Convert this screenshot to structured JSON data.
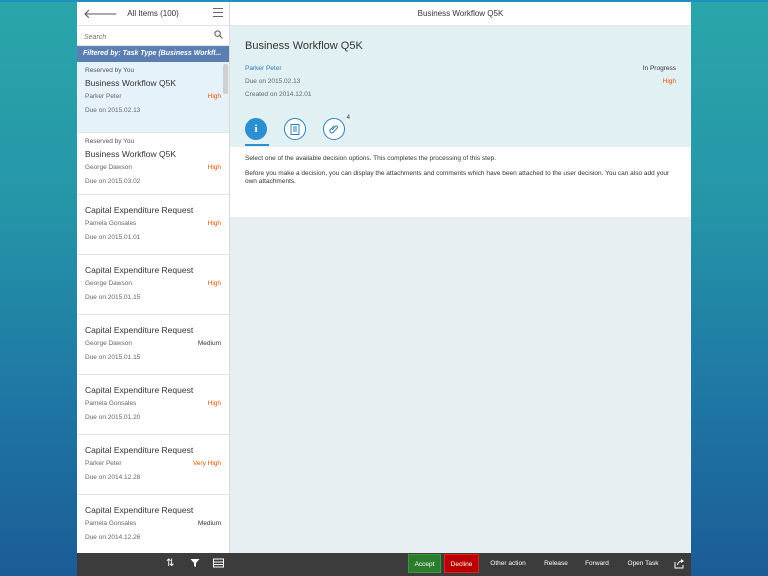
{
  "master": {
    "title": "All Items (100)",
    "search_placeholder": "Search",
    "filter": "Filtered by: Task Type (Business Workfl...",
    "items": [
      {
        "reserved": "Reserved by You",
        "title": "Business Workflow Q5K",
        "person": "Parker Peter",
        "priority": "High",
        "due": "Due on 2015.02.13"
      },
      {
        "reserved": "Reserved by You",
        "title": "Business Workflow Q5K",
        "person": "George Dawson",
        "priority": "High",
        "due": "Due on 2015.03.02"
      },
      {
        "title": "Capital Expenditure Request",
        "person": "Pamela Gonsales",
        "priority": "High",
        "due": "Due on 2015.01.01"
      },
      {
        "title": "Capital Expenditure Request",
        "person": "George Dawson",
        "priority": "High",
        "due": "Due on 2015.01.15"
      },
      {
        "title": "Capital Expenditure Request",
        "person": "George Dawson",
        "priority": "Medium",
        "due": "Due on 2015.01.15"
      },
      {
        "title": "Capital Expenditure Request",
        "person": "Pamela Gonsales",
        "priority": "High",
        "due": "Due on 2015.01.20"
      },
      {
        "title": "Capital Expenditure Request",
        "person": "Parker Peter",
        "priority": "Very High",
        "due": "Due on 2014.12.28"
      },
      {
        "title": "Capital Expenditure Request",
        "person": "Pamela Gonsales",
        "priority": "Medium",
        "due": "Due on 2014.12.26"
      }
    ]
  },
  "detail": {
    "header": "Business Workflow Q5K",
    "title": "Business Workflow Q5K",
    "owner": "Parker Peter",
    "status": "In Progress",
    "due": "Due on 2015.02.13",
    "priority": "High",
    "created": "Created on 2014.12.01",
    "attachments_count": "4",
    "text1": "Select one of the available decision options. This completes the processing of this step.",
    "text2": "Before you make a decision, you can display the attachments and comments which have been attached to the user decision. You can also add your own attachments."
  },
  "footer": {
    "accept": "Accept",
    "decline": "Decline",
    "other": "Other action",
    "release": "Release",
    "forward": "Forward",
    "open": "Open Task"
  },
  "colors": {
    "accent": "#2c8fd0",
    "priority_high": "#e35500",
    "accept": "#2b7d2b",
    "decline": "#bb0000"
  }
}
